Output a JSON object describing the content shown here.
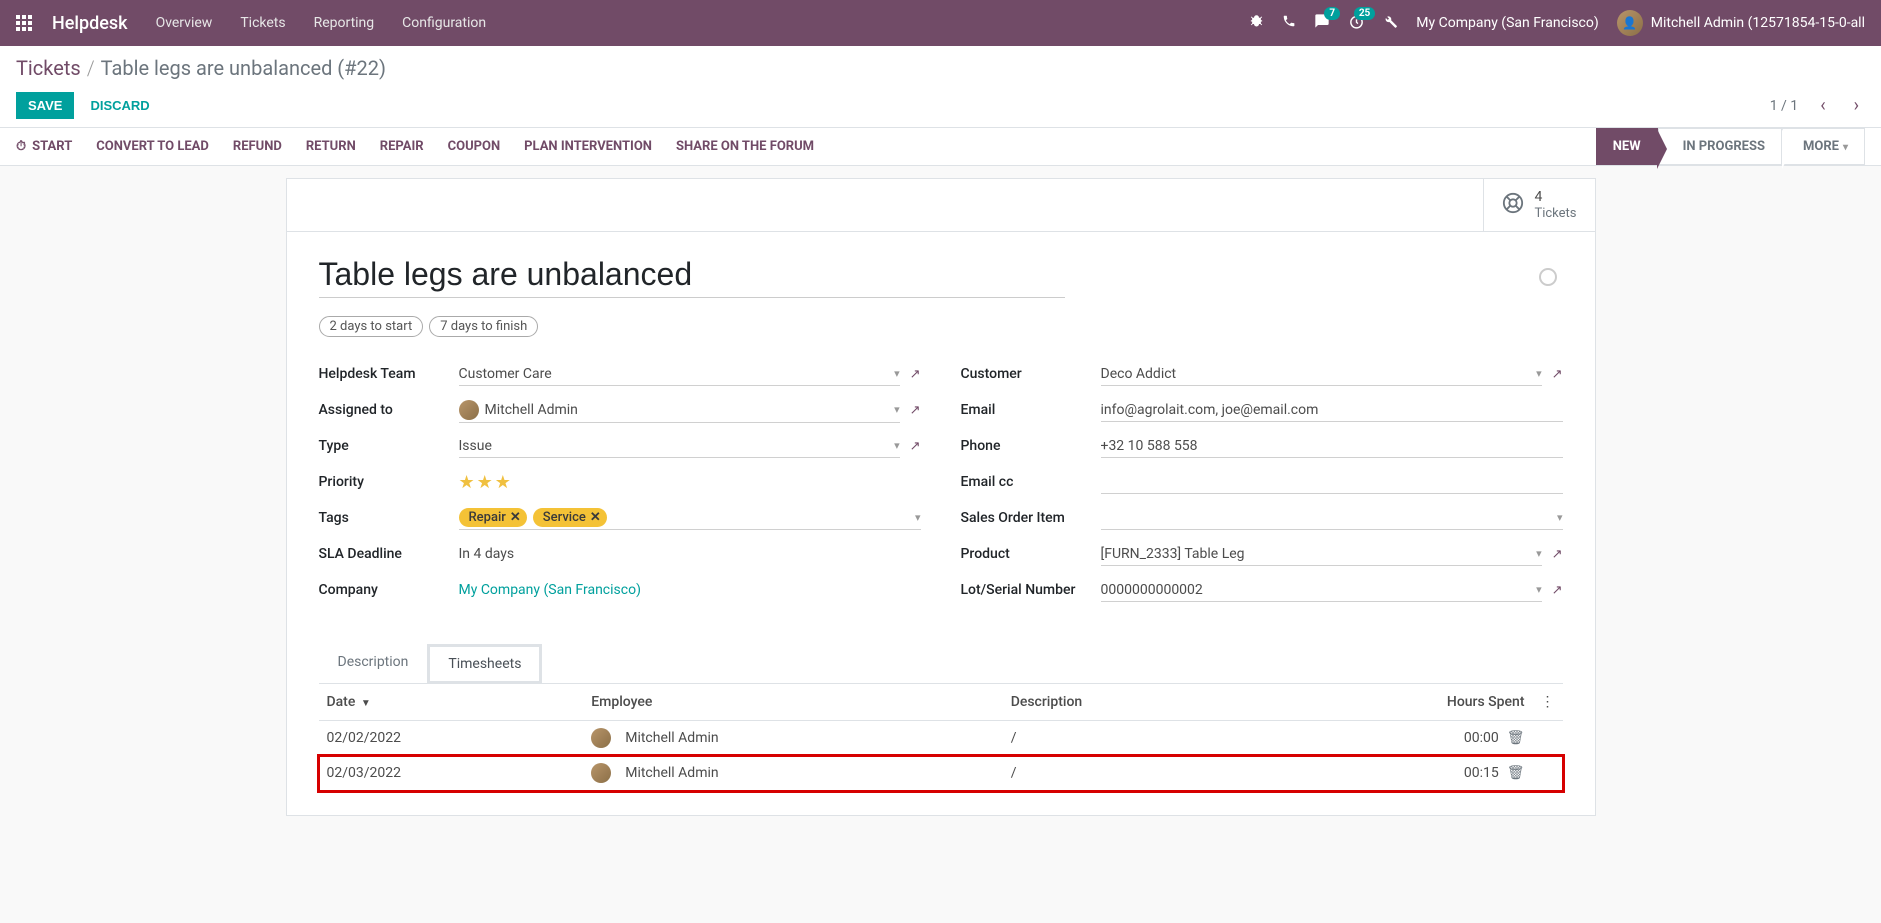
{
  "navbar": {
    "brand": "Helpdesk",
    "items": [
      "Overview",
      "Tickets",
      "Reporting",
      "Configuration"
    ],
    "msg_badge": "7",
    "timer_badge": "25",
    "company": "My Company (San Francisco)",
    "user": "Mitchell Admin (12571854-15-0-all"
  },
  "breadcrumb": {
    "parent": "Tickets",
    "current": "Table legs are unbalanced (#22)"
  },
  "buttons": {
    "save": "SAVE",
    "discard": "DISCARD"
  },
  "pager": {
    "text": "1 / 1"
  },
  "actions": {
    "start": "START",
    "convert": "CONVERT TO LEAD",
    "refund": "REFUND",
    "return": "RETURN",
    "repair": "REPAIR",
    "coupon": "COUPON",
    "plan": "PLAN INTERVENTION",
    "share": "SHARE ON THE FORUM"
  },
  "status": {
    "new": "NEW",
    "in_progress": "IN PROGRESS",
    "more": "MORE"
  },
  "stat": {
    "count": "4",
    "label": "Tickets"
  },
  "ticket": {
    "title": "Table legs are unbalanced",
    "pill1": "2 days to start",
    "pill2": "7 days to finish",
    "labels": {
      "team": "Helpdesk Team",
      "assigned": "Assigned to",
      "type": "Type",
      "priority": "Priority",
      "tags": "Tags",
      "sla": "SLA Deadline",
      "company": "Company",
      "customer": "Customer",
      "email": "Email",
      "phone": "Phone",
      "emailcc": "Email cc",
      "sales_order": "Sales Order Item",
      "product": "Product",
      "lot": "Lot/Serial Number"
    },
    "values": {
      "team": "Customer Care",
      "assigned": "Mitchell Admin",
      "type": "Issue",
      "sla": "In 4 days",
      "company": "My Company (San Francisco)",
      "customer": "Deco Addict",
      "email": "info@agrolait.com, joe@email.com",
      "phone": "+32 10 588 558",
      "emailcc": "",
      "sales_order": "",
      "product": "[FURN_2333] Table Leg",
      "lot": "0000000000002"
    },
    "tags": [
      "Repair",
      "Service"
    ]
  },
  "tabs": {
    "description": "Description",
    "timesheets": "Timesheets"
  },
  "table": {
    "headers": {
      "date": "Date",
      "employee": "Employee",
      "description": "Description",
      "hours": "Hours Spent"
    },
    "rows": [
      {
        "date": "02/02/2022",
        "employee": "Mitchell Admin",
        "desc": "/",
        "hours": "00:00"
      },
      {
        "date": "02/03/2022",
        "employee": "Mitchell Admin",
        "desc": "/",
        "hours": "00:15"
      }
    ]
  }
}
